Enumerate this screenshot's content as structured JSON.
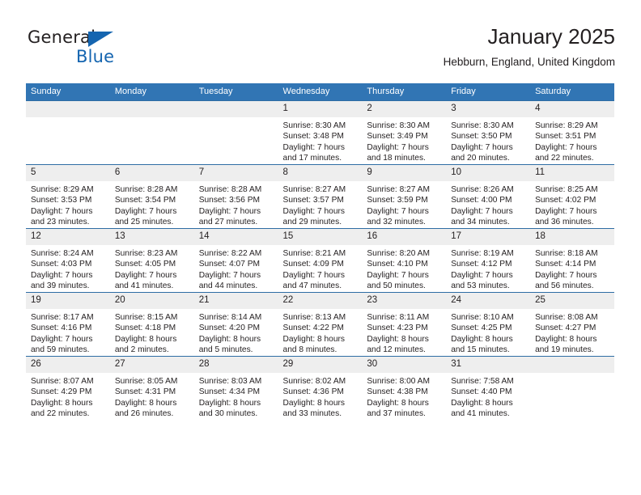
{
  "brand": {
    "line1": "General",
    "line2": "Blue",
    "accent_color": "#1565b0"
  },
  "header": {
    "title": "January 2025",
    "subtitle": "Hebburn, England, United Kingdom"
  },
  "theme": {
    "header_blue": "#3175b4",
    "row_line_blue": "#2e6da4",
    "daynum_gray": "#eeeeee",
    "text": "#231f20"
  },
  "calendar": {
    "weekday_headers": [
      "Sunday",
      "Monday",
      "Tuesday",
      "Wednesday",
      "Thursday",
      "Friday",
      "Saturday"
    ],
    "labels": {
      "sunrise": "Sunrise:",
      "sunset": "Sunset:",
      "daylight": "Daylight:"
    },
    "weeks": [
      [
        {
          "day": "",
          "empty": true
        },
        {
          "day": "",
          "empty": true
        },
        {
          "day": "",
          "empty": true
        },
        {
          "day": "1",
          "sunrise": "Sunrise: 8:30 AM",
          "sunset": "Sunset: 3:48 PM",
          "daylight": "Daylight: 7 hours and 17 minutes."
        },
        {
          "day": "2",
          "sunrise": "Sunrise: 8:30 AM",
          "sunset": "Sunset: 3:49 PM",
          "daylight": "Daylight: 7 hours and 18 minutes."
        },
        {
          "day": "3",
          "sunrise": "Sunrise: 8:30 AM",
          "sunset": "Sunset: 3:50 PM",
          "daylight": "Daylight: 7 hours and 20 minutes."
        },
        {
          "day": "4",
          "sunrise": "Sunrise: 8:29 AM",
          "sunset": "Sunset: 3:51 PM",
          "daylight": "Daylight: 7 hours and 22 minutes."
        }
      ],
      [
        {
          "day": "5",
          "sunrise": "Sunrise: 8:29 AM",
          "sunset": "Sunset: 3:53 PM",
          "daylight": "Daylight: 7 hours and 23 minutes."
        },
        {
          "day": "6",
          "sunrise": "Sunrise: 8:28 AM",
          "sunset": "Sunset: 3:54 PM",
          "daylight": "Daylight: 7 hours and 25 minutes."
        },
        {
          "day": "7",
          "sunrise": "Sunrise: 8:28 AM",
          "sunset": "Sunset: 3:56 PM",
          "daylight": "Daylight: 7 hours and 27 minutes."
        },
        {
          "day": "8",
          "sunrise": "Sunrise: 8:27 AM",
          "sunset": "Sunset: 3:57 PM",
          "daylight": "Daylight: 7 hours and 29 minutes."
        },
        {
          "day": "9",
          "sunrise": "Sunrise: 8:27 AM",
          "sunset": "Sunset: 3:59 PM",
          "daylight": "Daylight: 7 hours and 32 minutes."
        },
        {
          "day": "10",
          "sunrise": "Sunrise: 8:26 AM",
          "sunset": "Sunset: 4:00 PM",
          "daylight": "Daylight: 7 hours and 34 minutes."
        },
        {
          "day": "11",
          "sunrise": "Sunrise: 8:25 AM",
          "sunset": "Sunset: 4:02 PM",
          "daylight": "Daylight: 7 hours and 36 minutes."
        }
      ],
      [
        {
          "day": "12",
          "sunrise": "Sunrise: 8:24 AM",
          "sunset": "Sunset: 4:03 PM",
          "daylight": "Daylight: 7 hours and 39 minutes."
        },
        {
          "day": "13",
          "sunrise": "Sunrise: 8:23 AM",
          "sunset": "Sunset: 4:05 PM",
          "daylight": "Daylight: 7 hours and 41 minutes."
        },
        {
          "day": "14",
          "sunrise": "Sunrise: 8:22 AM",
          "sunset": "Sunset: 4:07 PM",
          "daylight": "Daylight: 7 hours and 44 minutes."
        },
        {
          "day": "15",
          "sunrise": "Sunrise: 8:21 AM",
          "sunset": "Sunset: 4:09 PM",
          "daylight": "Daylight: 7 hours and 47 minutes."
        },
        {
          "day": "16",
          "sunrise": "Sunrise: 8:20 AM",
          "sunset": "Sunset: 4:10 PM",
          "daylight": "Daylight: 7 hours and 50 minutes."
        },
        {
          "day": "17",
          "sunrise": "Sunrise: 8:19 AM",
          "sunset": "Sunset: 4:12 PM",
          "daylight": "Daylight: 7 hours and 53 minutes."
        },
        {
          "day": "18",
          "sunrise": "Sunrise: 8:18 AM",
          "sunset": "Sunset: 4:14 PM",
          "daylight": "Daylight: 7 hours and 56 minutes."
        }
      ],
      [
        {
          "day": "19",
          "sunrise": "Sunrise: 8:17 AM",
          "sunset": "Sunset: 4:16 PM",
          "daylight": "Daylight: 7 hours and 59 minutes."
        },
        {
          "day": "20",
          "sunrise": "Sunrise: 8:15 AM",
          "sunset": "Sunset: 4:18 PM",
          "daylight": "Daylight: 8 hours and 2 minutes."
        },
        {
          "day": "21",
          "sunrise": "Sunrise: 8:14 AM",
          "sunset": "Sunset: 4:20 PM",
          "daylight": "Daylight: 8 hours and 5 minutes."
        },
        {
          "day": "22",
          "sunrise": "Sunrise: 8:13 AM",
          "sunset": "Sunset: 4:22 PM",
          "daylight": "Daylight: 8 hours and 8 minutes."
        },
        {
          "day": "23",
          "sunrise": "Sunrise: 8:11 AM",
          "sunset": "Sunset: 4:23 PM",
          "daylight": "Daylight: 8 hours and 12 minutes."
        },
        {
          "day": "24",
          "sunrise": "Sunrise: 8:10 AM",
          "sunset": "Sunset: 4:25 PM",
          "daylight": "Daylight: 8 hours and 15 minutes."
        },
        {
          "day": "25",
          "sunrise": "Sunrise: 8:08 AM",
          "sunset": "Sunset: 4:27 PM",
          "daylight": "Daylight: 8 hours and 19 minutes."
        }
      ],
      [
        {
          "day": "26",
          "sunrise": "Sunrise: 8:07 AM",
          "sunset": "Sunset: 4:29 PM",
          "daylight": "Daylight: 8 hours and 22 minutes."
        },
        {
          "day": "27",
          "sunrise": "Sunrise: 8:05 AM",
          "sunset": "Sunset: 4:31 PM",
          "daylight": "Daylight: 8 hours and 26 minutes."
        },
        {
          "day": "28",
          "sunrise": "Sunrise: 8:03 AM",
          "sunset": "Sunset: 4:34 PM",
          "daylight": "Daylight: 8 hours and 30 minutes."
        },
        {
          "day": "29",
          "sunrise": "Sunrise: 8:02 AM",
          "sunset": "Sunset: 4:36 PM",
          "daylight": "Daylight: 8 hours and 33 minutes."
        },
        {
          "day": "30",
          "sunrise": "Sunrise: 8:00 AM",
          "sunset": "Sunset: 4:38 PM",
          "daylight": "Daylight: 8 hours and 37 minutes."
        },
        {
          "day": "31",
          "sunrise": "Sunrise: 7:58 AM",
          "sunset": "Sunset: 4:40 PM",
          "daylight": "Daylight: 8 hours and 41 minutes."
        },
        {
          "day": "",
          "empty": true
        }
      ]
    ]
  }
}
